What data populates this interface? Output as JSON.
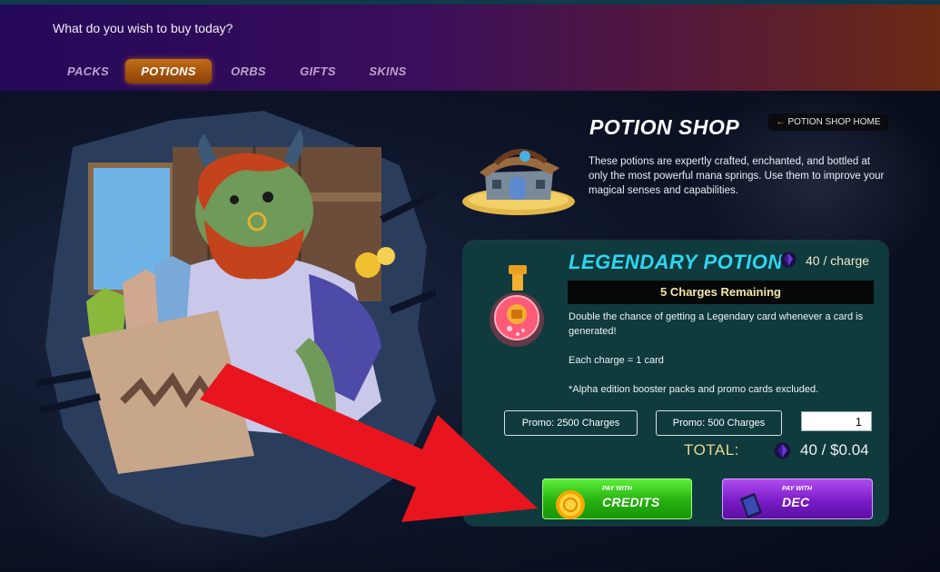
{
  "header": {
    "title": "What do you wish to buy today?",
    "tabs": [
      {
        "label": "PACKS",
        "active": false
      },
      {
        "label": "POTIONS",
        "active": true
      },
      {
        "label": "ORBS",
        "active": false
      },
      {
        "label": "GIFTS",
        "active": false
      },
      {
        "label": "SKINS",
        "active": false
      }
    ]
  },
  "shop": {
    "title": "POTION SHOP",
    "home_button": "POTION SHOP HOME",
    "description": "These potions are expertly crafted, enchanted, and bottled at only the most powerful mana springs. Use them to improve your magical senses and capabilities."
  },
  "potion": {
    "name": "LEGENDARY POTION",
    "price": "40 / charge",
    "charges_remaining": "5 Charges Remaining",
    "description": "Double the chance of getting a Legendary card whenever a card is generated!",
    "charge_info": "Each charge = 1 card",
    "note": "*Alpha edition booster packs and promo cards excluded.",
    "promo_buttons": [
      "Promo: 2500 Charges",
      "Promo: 500 Charges"
    ],
    "quantity": "1",
    "total_label": "TOTAL:",
    "total_value": "40 / $0.04"
  },
  "pay": {
    "credits": {
      "small": "PAY WITH",
      "label": "CREDITS"
    },
    "dec": {
      "small": "PAY WITH",
      "label": "DEC"
    }
  },
  "colors": {
    "accent_cyan": "#2ed6f0",
    "card_bg": "#0f3a3e",
    "credits_green": "#26b010",
    "dec_purple": "#7a1cc8",
    "active_tab": "#c26d13",
    "arrow_red": "#e8151e"
  }
}
